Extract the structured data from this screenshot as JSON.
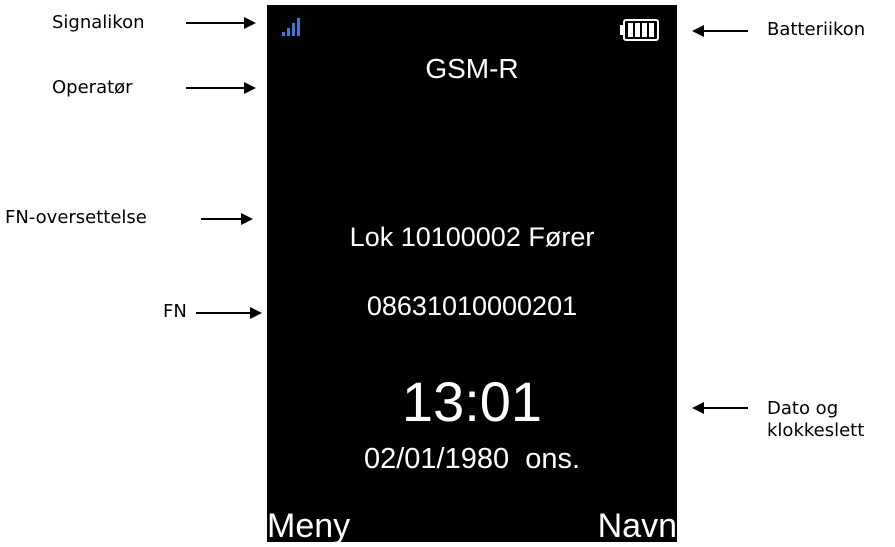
{
  "callouts": {
    "signal": "Signalikon",
    "operator": "Operatør",
    "fn_translation": "FN-oversettelse",
    "fn": "FN",
    "battery": "Batteriikon",
    "datetime_line1": "Dato og",
    "datetime_line2": "klokkeslett"
  },
  "screen": {
    "operator": "GSM-R",
    "fn_translation": "Lok 10100002 Fører",
    "fn_number": "08631010000201",
    "time": "13:01",
    "date": "02/01/1980  ons.",
    "softkey_left": "Meny",
    "softkey_right": "Navn",
    "signal_color": "#3a7bd5"
  }
}
